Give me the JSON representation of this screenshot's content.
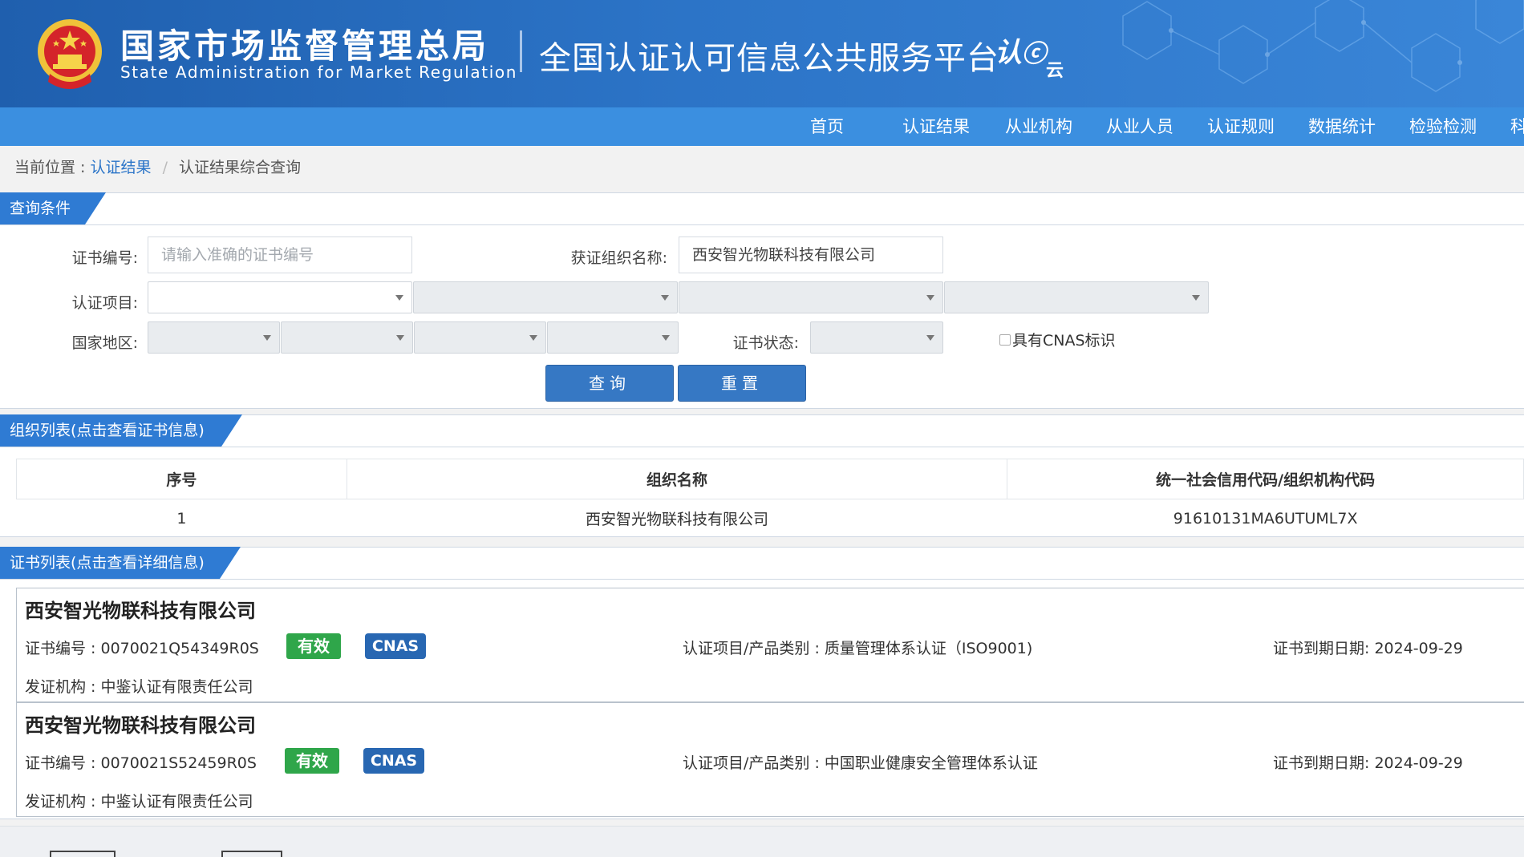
{
  "header": {
    "brand_cn": "国家市场监督管理总局",
    "brand_en": "State Administration  for  Market Regulation",
    "platform_title": "全国认证认可信息公共服务平台",
    "logo_text_main": "认",
    "logo_text_sub": "云",
    "colors": {
      "header_bg": "#2c74c7",
      "nav_bg": "#3b8fe0",
      "accent": "#2f7bd3"
    }
  },
  "nav": {
    "items": [
      "首页",
      "认证结果",
      "从业机构",
      "从业人员",
      "认证规则",
      "数据统计",
      "检验检测",
      "科技"
    ]
  },
  "breadcrumb": {
    "label": "当前位置 :",
    "link": "认证结果",
    "separator": "/",
    "current": "认证结果综合查询"
  },
  "query": {
    "section_title": "查询条件",
    "cert_no_label": "证书编号:",
    "cert_no_placeholder": "请输入准确的证书编号",
    "cert_no_value": "",
    "org_label": "获证组织名称:",
    "org_value": "西安智光物联科技有限公司",
    "project_label": "认证项目:",
    "region_label": "国家地区:",
    "status_label": "证书状态:",
    "cnas_label": "具有CNAS标识",
    "search_button": "查询",
    "reset_button": "重置"
  },
  "org_list": {
    "section_title": "组织列表(点击查看证书信息)",
    "columns": [
      "序号",
      "组织名称",
      "统一社会信用代码/组织机构代码"
    ],
    "rows": [
      {
        "index": "1",
        "name": "西安智光物联科技有限公司",
        "code": "91610131MA6UTUML7X"
      }
    ]
  },
  "cert_list": {
    "section_title": "证书列表(点击查看详细信息)",
    "items": [
      {
        "org": "西安智光物联科技有限公司",
        "cert_no": "证书编号 : 0070021Q54349R0S",
        "status": "有效",
        "cnas": "CNAS",
        "project": "认证项目/产品类别 : 质量管理体系认证（ISO9001)",
        "expire": "证书到期日期: 2024-09-29",
        "issuer": "发证机构 : 中鉴认证有限责任公司"
      },
      {
        "org": "西安智光物联科技有限公司",
        "cert_no": "证书编号 : 0070021S52459R0S",
        "status": "有效",
        "cnas": "CNAS",
        "project": "认证项目/产品类别 : 中国职业健康安全管理体系认证",
        "expire": "证书到期日期: 2024-09-29",
        "issuer": "发证机构 : 中鉴认证有限责任公司"
      }
    ]
  }
}
